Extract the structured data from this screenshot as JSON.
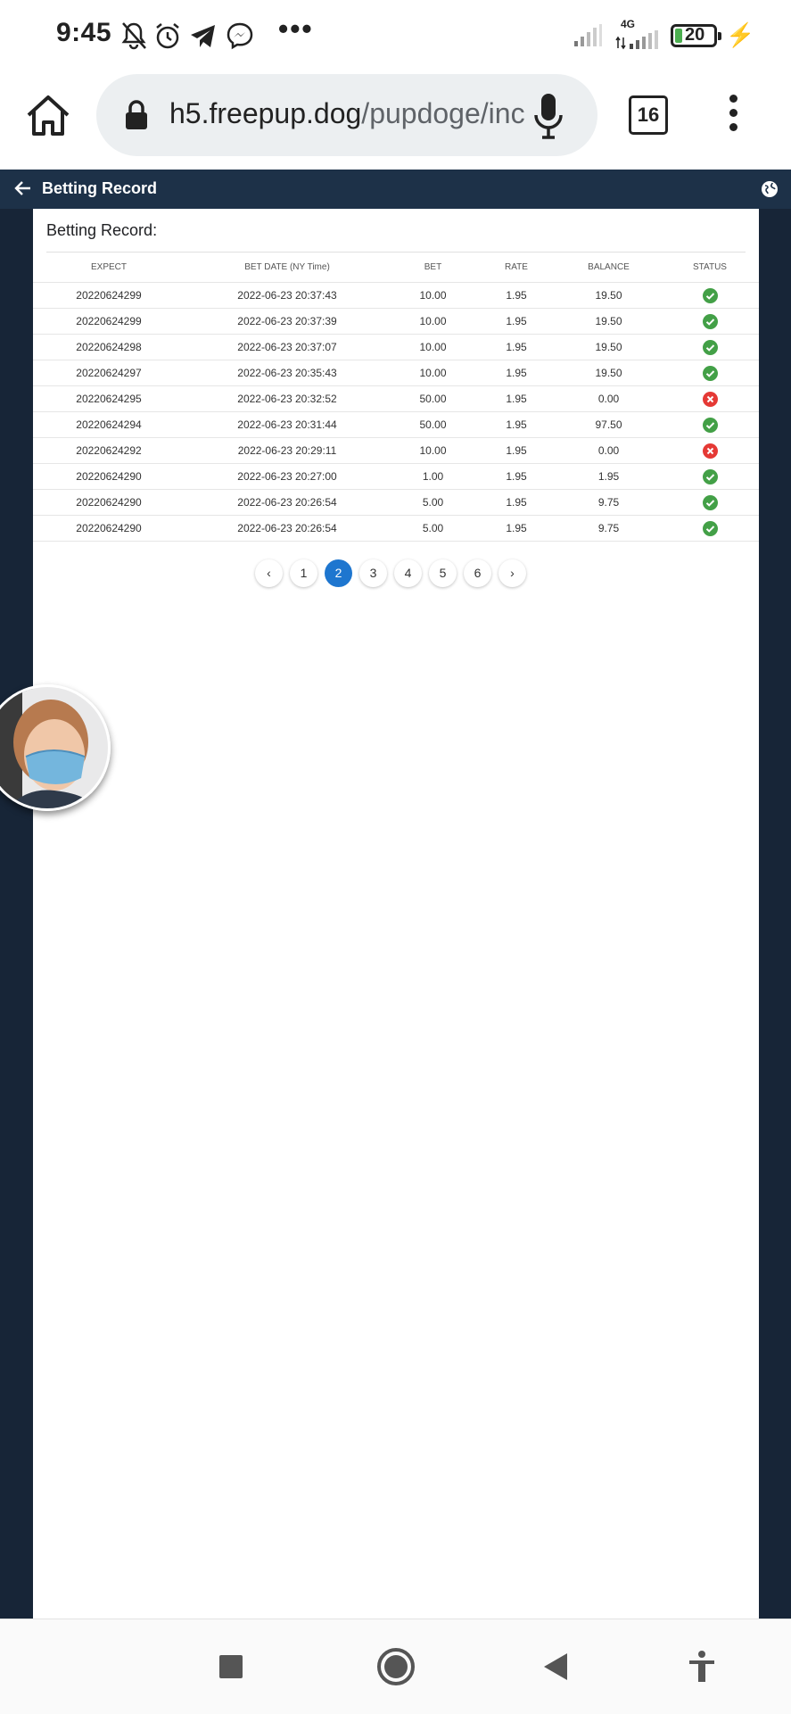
{
  "status_bar": {
    "time": "9:45",
    "icons": [
      "bell-off-icon",
      "alarm-icon",
      "telegram-icon",
      "messenger-icon"
    ],
    "more": "•••",
    "network_label": "4G",
    "battery": "20",
    "charging": true
  },
  "browser": {
    "url_host": "h5.freepup.dog",
    "url_path": "/pupdoge/inc",
    "tab_count": "16"
  },
  "app": {
    "title": "Betting Record",
    "header_color": "#1d3148"
  },
  "records": {
    "section_title": "Betting Record:",
    "columns": [
      "EXPECT",
      "BET DATE (NY Time)",
      "BET",
      "RATE",
      "BALANCE",
      "STATUS"
    ],
    "rows": [
      {
        "expect": "20220624299",
        "date": "2022-06-23 20:37:43",
        "bet": "10.00",
        "rate": "1.95",
        "balance": "19.50",
        "status": "win"
      },
      {
        "expect": "20220624299",
        "date": "2022-06-23 20:37:39",
        "bet": "10.00",
        "rate": "1.95",
        "balance": "19.50",
        "status": "win"
      },
      {
        "expect": "20220624298",
        "date": "2022-06-23 20:37:07",
        "bet": "10.00",
        "rate": "1.95",
        "balance": "19.50",
        "status": "win"
      },
      {
        "expect": "20220624297",
        "date": "2022-06-23 20:35:43",
        "bet": "10.00",
        "rate": "1.95",
        "balance": "19.50",
        "status": "win"
      },
      {
        "expect": "20220624295",
        "date": "2022-06-23 20:32:52",
        "bet": "50.00",
        "rate": "1.95",
        "balance": "0.00",
        "status": "loss"
      },
      {
        "expect": "20220624294",
        "date": "2022-06-23 20:31:44",
        "bet": "50.00",
        "rate": "1.95",
        "balance": "97.50",
        "status": "win"
      },
      {
        "expect": "20220624292",
        "date": "2022-06-23 20:29:11",
        "bet": "10.00",
        "rate": "1.95",
        "balance": "0.00",
        "status": "loss"
      },
      {
        "expect": "20220624290",
        "date": "2022-06-23 20:27:00",
        "bet": "1.00",
        "rate": "1.95",
        "balance": "1.95",
        "status": "win"
      },
      {
        "expect": "20220624290",
        "date": "2022-06-23 20:26:54",
        "bet": "5.00",
        "rate": "1.95",
        "balance": "9.75",
        "status": "win"
      },
      {
        "expect": "20220624290",
        "date": "2022-06-23 20:26:54",
        "bet": "5.00",
        "rate": "1.95",
        "balance": "9.75",
        "status": "win"
      }
    ],
    "status_colors": {
      "win": "#43a047",
      "loss": "#e53935"
    }
  },
  "pagination": {
    "prev": "‹",
    "pages": [
      "1",
      "2",
      "3",
      "4",
      "5",
      "6"
    ],
    "current": "2",
    "next": "›"
  },
  "nav_bar": {
    "icons": [
      "recents-square-icon",
      "home-circle-icon",
      "back-triangle-icon",
      "accessibility-icon"
    ]
  }
}
